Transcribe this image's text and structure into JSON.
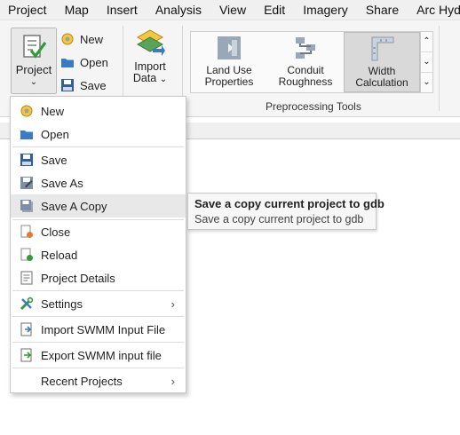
{
  "menubar": {
    "items": [
      "Project",
      "Map",
      "Insert",
      "Analysis",
      "View",
      "Edit",
      "Imagery",
      "Share",
      "Arc Hydro"
    ]
  },
  "ribbon": {
    "project_label": "Project",
    "new_label": "New",
    "open_label": "Open",
    "save_label": "Save",
    "import_label_1": "Import",
    "import_label_2": "Data",
    "gallery": [
      {
        "line1": "Land Use",
        "line2": "Properties"
      },
      {
        "line1": "Conduit",
        "line2": "Roughness"
      },
      {
        "line1": "Width",
        "line2": "Calculation"
      }
    ],
    "group_label": "Preprocessing Tools"
  },
  "dropdown": {
    "items": [
      {
        "label": "New"
      },
      {
        "label": "Open"
      },
      {
        "label": "Save"
      },
      {
        "label": "Save As"
      },
      {
        "label": "Save A Copy"
      },
      {
        "label": "Close"
      },
      {
        "label": "Reload"
      },
      {
        "label": "Project Details"
      },
      {
        "label": "Settings"
      },
      {
        "label": "Import SWMM Input File"
      },
      {
        "label": "Export SWMM input file"
      },
      {
        "label": "Recent Projects"
      }
    ]
  },
  "tooltip": {
    "title": "Save a copy current project to gdb",
    "body": "Save a copy current project to gdb"
  },
  "colors": {
    "highlight": "#e8e8e8",
    "folder": "#3a7bc8",
    "check": "#2e9c3a"
  }
}
